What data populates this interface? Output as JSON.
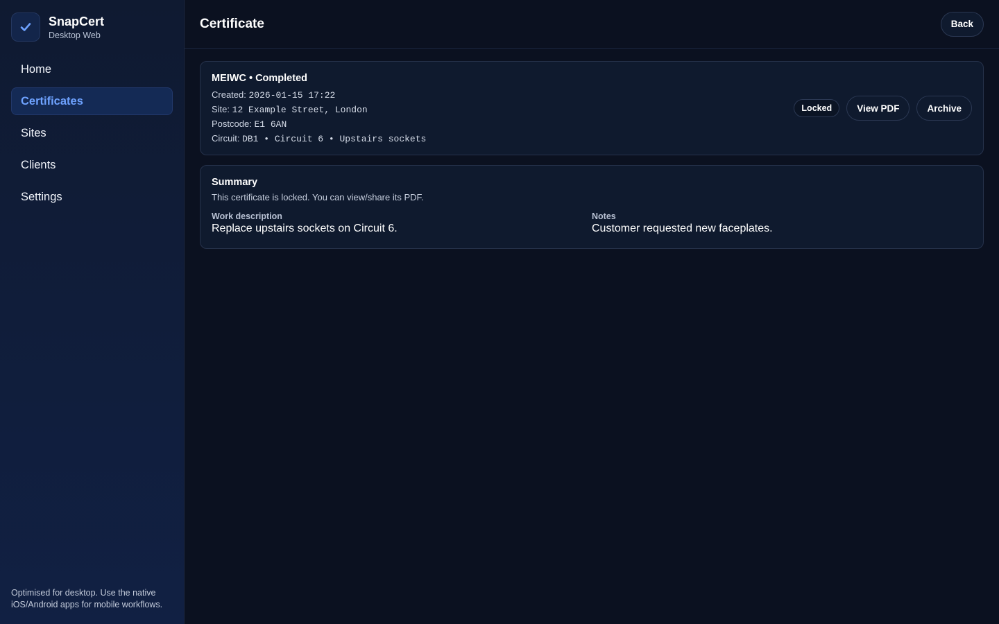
{
  "brand": {
    "name": "SnapCert",
    "subtitle": "Desktop Web",
    "logo_icon": "check-icon",
    "accent_color": "#6ea2ff"
  },
  "sidebar": {
    "items": [
      {
        "label": "Home",
        "active": false
      },
      {
        "label": "Certificates",
        "active": true
      },
      {
        "label": "Sites",
        "active": false
      },
      {
        "label": "Clients",
        "active": false
      },
      {
        "label": "Settings",
        "active": false
      }
    ],
    "footer": "Optimised for desktop. Use the native iOS/Android apps for mobile workflows."
  },
  "header": {
    "title": "Certificate",
    "back_label": "Back"
  },
  "certificate": {
    "title": "MEIWC • Completed",
    "created_label": "Created:",
    "created_value": "2026-01-15 17:22",
    "site_label": "Site:",
    "site_value": "12 Example Street, London",
    "postcode_label": "Postcode:",
    "postcode_value": "E1 6AN",
    "circuit_label": "Circuit:",
    "circuit_value": "DB1 • Circuit 6 • Upstairs sockets",
    "status_badge": "Locked",
    "view_pdf_label": "View PDF",
    "archive_label": "Archive"
  },
  "summary": {
    "title": "Summary",
    "text": "This certificate is locked. You can view/share its PDF.",
    "work_description_label": "Work description",
    "work_description_value": "Replace upstairs sockets on Circuit 6.",
    "notes_label": "Notes",
    "notes_value": "Customer requested new faceplates."
  }
}
